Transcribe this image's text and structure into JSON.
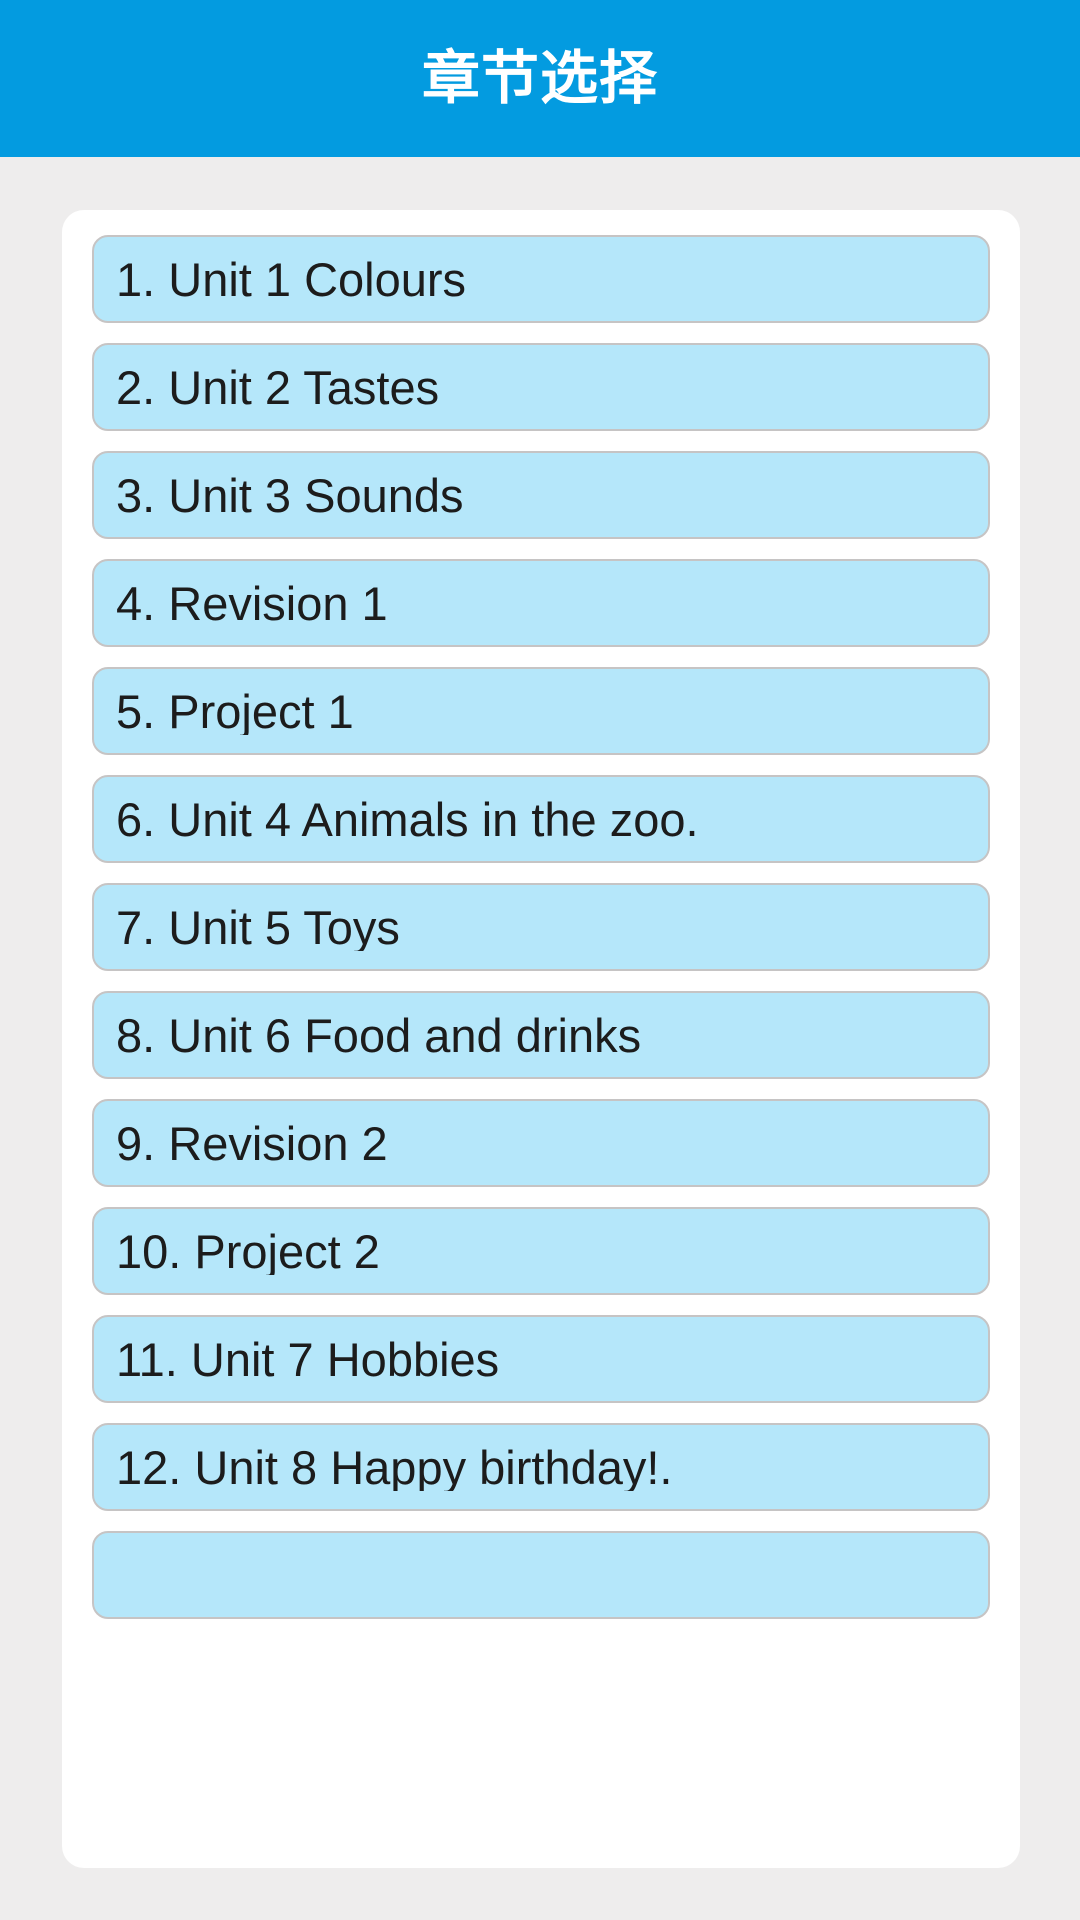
{
  "header": {
    "title": "章节选择",
    "background_color": "#039be0",
    "text_color": "#ffffff"
  },
  "theme": {
    "page_background": "#eeeded",
    "card_background": "#ffffff",
    "item_background": "#b5e7fa",
    "item_border": "#c6c4c4",
    "item_text": "#1c1c1c"
  },
  "chapter_list": {
    "items": [
      {
        "label": "1. Unit 1 Colours"
      },
      {
        "label": "2. Unit 2 Tastes"
      },
      {
        "label": "3. Unit 3 Sounds"
      },
      {
        "label": "4. Revision 1"
      },
      {
        "label": "5. Project 1"
      },
      {
        "label": "6. Unit 4 Animals in the zoo."
      },
      {
        "label": "7. Unit 5 Toys"
      },
      {
        "label": "8. Unit 6 Food and drinks"
      },
      {
        "label": "9. Revision 2"
      },
      {
        "label": "10. Project 2"
      },
      {
        "label": "11. Unit 7 Hobbies"
      },
      {
        "label": "12. Unit 8 Happy birthday!."
      },
      {
        "label": ""
      }
    ]
  }
}
